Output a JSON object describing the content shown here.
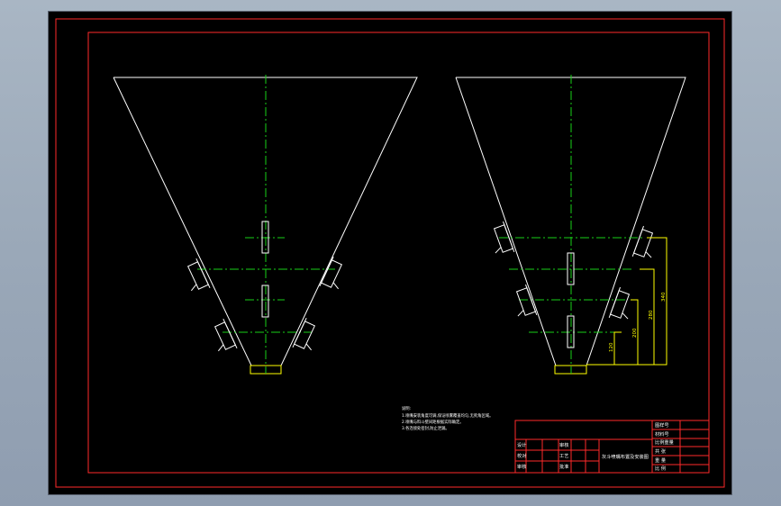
{
  "colors": {
    "frame": "#ff2a2a",
    "outline": "#ffffff",
    "centerline": "#19d119",
    "dimension": "#ffff00",
    "background": "#000000"
  },
  "drawing": {
    "notes_heading": "说明:",
    "notes": [
      "1.喷嘴安装角度可调,保证喷雾覆盖均匀,无死角区域。",
      "2.喷嘴与料斗壁间距根据实际确定。",
      "3.各连接处密封,防止泄漏。"
    ],
    "dimension_labels": [
      "340",
      "280",
      "200",
      "120"
    ],
    "title_block": {
      "title": "灰斗喷嘴布置及安装图",
      "left_rows": [
        {
          "role": "设计",
          "check": "审核"
        },
        {
          "role": "校对",
          "check": "工艺"
        },
        {
          "role": "审核",
          "check": "批准"
        }
      ],
      "right_rows": [
        "图样号",
        "材料号",
        "比例重量",
        "共  张",
        "重  量",
        "比  例"
      ]
    }
  }
}
